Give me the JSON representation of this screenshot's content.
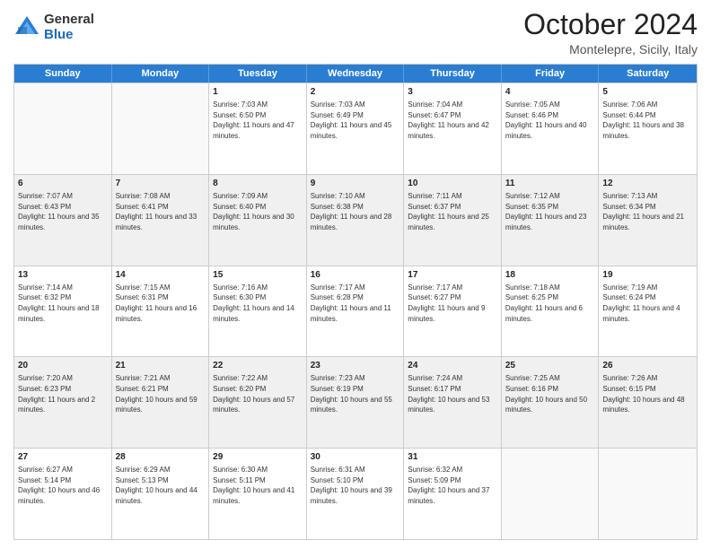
{
  "logo": {
    "general": "General",
    "blue": "Blue"
  },
  "title": {
    "month": "October 2024",
    "location": "Montelepre, Sicily, Italy"
  },
  "weekdays": [
    "Sunday",
    "Monday",
    "Tuesday",
    "Wednesday",
    "Thursday",
    "Friday",
    "Saturday"
  ],
  "weeks": [
    [
      {
        "day": "",
        "sunrise": "",
        "sunset": "",
        "daylight": "",
        "shaded": false,
        "empty": true
      },
      {
        "day": "",
        "sunrise": "",
        "sunset": "",
        "daylight": "",
        "shaded": false,
        "empty": true
      },
      {
        "day": "1",
        "sunrise": "Sunrise: 7:03 AM",
        "sunset": "Sunset: 6:50 PM",
        "daylight": "Daylight: 11 hours and 47 minutes.",
        "shaded": false,
        "empty": false
      },
      {
        "day": "2",
        "sunrise": "Sunrise: 7:03 AM",
        "sunset": "Sunset: 6:49 PM",
        "daylight": "Daylight: 11 hours and 45 minutes.",
        "shaded": false,
        "empty": false
      },
      {
        "day": "3",
        "sunrise": "Sunrise: 7:04 AM",
        "sunset": "Sunset: 6:47 PM",
        "daylight": "Daylight: 11 hours and 42 minutes.",
        "shaded": false,
        "empty": false
      },
      {
        "day": "4",
        "sunrise": "Sunrise: 7:05 AM",
        "sunset": "Sunset: 6:46 PM",
        "daylight": "Daylight: 11 hours and 40 minutes.",
        "shaded": false,
        "empty": false
      },
      {
        "day": "5",
        "sunrise": "Sunrise: 7:06 AM",
        "sunset": "Sunset: 6:44 PM",
        "daylight": "Daylight: 11 hours and 38 minutes.",
        "shaded": false,
        "empty": false
      }
    ],
    [
      {
        "day": "6",
        "sunrise": "Sunrise: 7:07 AM",
        "sunset": "Sunset: 6:43 PM",
        "daylight": "Daylight: 11 hours and 35 minutes.",
        "shaded": true,
        "empty": false
      },
      {
        "day": "7",
        "sunrise": "Sunrise: 7:08 AM",
        "sunset": "Sunset: 6:41 PM",
        "daylight": "Daylight: 11 hours and 33 minutes.",
        "shaded": true,
        "empty": false
      },
      {
        "day": "8",
        "sunrise": "Sunrise: 7:09 AM",
        "sunset": "Sunset: 6:40 PM",
        "daylight": "Daylight: 11 hours and 30 minutes.",
        "shaded": true,
        "empty": false
      },
      {
        "day": "9",
        "sunrise": "Sunrise: 7:10 AM",
        "sunset": "Sunset: 6:38 PM",
        "daylight": "Daylight: 11 hours and 28 minutes.",
        "shaded": true,
        "empty": false
      },
      {
        "day": "10",
        "sunrise": "Sunrise: 7:11 AM",
        "sunset": "Sunset: 6:37 PM",
        "daylight": "Daylight: 11 hours and 25 minutes.",
        "shaded": true,
        "empty": false
      },
      {
        "day": "11",
        "sunrise": "Sunrise: 7:12 AM",
        "sunset": "Sunset: 6:35 PM",
        "daylight": "Daylight: 11 hours and 23 minutes.",
        "shaded": true,
        "empty": false
      },
      {
        "day": "12",
        "sunrise": "Sunrise: 7:13 AM",
        "sunset": "Sunset: 6:34 PM",
        "daylight": "Daylight: 11 hours and 21 minutes.",
        "shaded": true,
        "empty": false
      }
    ],
    [
      {
        "day": "13",
        "sunrise": "Sunrise: 7:14 AM",
        "sunset": "Sunset: 6:32 PM",
        "daylight": "Daylight: 11 hours and 18 minutes.",
        "shaded": false,
        "empty": false
      },
      {
        "day": "14",
        "sunrise": "Sunrise: 7:15 AM",
        "sunset": "Sunset: 6:31 PM",
        "daylight": "Daylight: 11 hours and 16 minutes.",
        "shaded": false,
        "empty": false
      },
      {
        "day": "15",
        "sunrise": "Sunrise: 7:16 AM",
        "sunset": "Sunset: 6:30 PM",
        "daylight": "Daylight: 11 hours and 14 minutes.",
        "shaded": false,
        "empty": false
      },
      {
        "day": "16",
        "sunrise": "Sunrise: 7:17 AM",
        "sunset": "Sunset: 6:28 PM",
        "daylight": "Daylight: 11 hours and 11 minutes.",
        "shaded": false,
        "empty": false
      },
      {
        "day": "17",
        "sunrise": "Sunrise: 7:17 AM",
        "sunset": "Sunset: 6:27 PM",
        "daylight": "Daylight: 11 hours and 9 minutes.",
        "shaded": false,
        "empty": false
      },
      {
        "day": "18",
        "sunrise": "Sunrise: 7:18 AM",
        "sunset": "Sunset: 6:25 PM",
        "daylight": "Daylight: 11 hours and 6 minutes.",
        "shaded": false,
        "empty": false
      },
      {
        "day": "19",
        "sunrise": "Sunrise: 7:19 AM",
        "sunset": "Sunset: 6:24 PM",
        "daylight": "Daylight: 11 hours and 4 minutes.",
        "shaded": false,
        "empty": false
      }
    ],
    [
      {
        "day": "20",
        "sunrise": "Sunrise: 7:20 AM",
        "sunset": "Sunset: 6:23 PM",
        "daylight": "Daylight: 11 hours and 2 minutes.",
        "shaded": true,
        "empty": false
      },
      {
        "day": "21",
        "sunrise": "Sunrise: 7:21 AM",
        "sunset": "Sunset: 6:21 PM",
        "daylight": "Daylight: 10 hours and 59 minutes.",
        "shaded": true,
        "empty": false
      },
      {
        "day": "22",
        "sunrise": "Sunrise: 7:22 AM",
        "sunset": "Sunset: 6:20 PM",
        "daylight": "Daylight: 10 hours and 57 minutes.",
        "shaded": true,
        "empty": false
      },
      {
        "day": "23",
        "sunrise": "Sunrise: 7:23 AM",
        "sunset": "Sunset: 6:19 PM",
        "daylight": "Daylight: 10 hours and 55 minutes.",
        "shaded": true,
        "empty": false
      },
      {
        "day": "24",
        "sunrise": "Sunrise: 7:24 AM",
        "sunset": "Sunset: 6:17 PM",
        "daylight": "Daylight: 10 hours and 53 minutes.",
        "shaded": true,
        "empty": false
      },
      {
        "day": "25",
        "sunrise": "Sunrise: 7:25 AM",
        "sunset": "Sunset: 6:16 PM",
        "daylight": "Daylight: 10 hours and 50 minutes.",
        "shaded": true,
        "empty": false
      },
      {
        "day": "26",
        "sunrise": "Sunrise: 7:26 AM",
        "sunset": "Sunset: 6:15 PM",
        "daylight": "Daylight: 10 hours and 48 minutes.",
        "shaded": true,
        "empty": false
      }
    ],
    [
      {
        "day": "27",
        "sunrise": "Sunrise: 6:27 AM",
        "sunset": "Sunset: 5:14 PM",
        "daylight": "Daylight: 10 hours and 46 minutes.",
        "shaded": false,
        "empty": false
      },
      {
        "day": "28",
        "sunrise": "Sunrise: 6:29 AM",
        "sunset": "Sunset: 5:13 PM",
        "daylight": "Daylight: 10 hours and 44 minutes.",
        "shaded": false,
        "empty": false
      },
      {
        "day": "29",
        "sunrise": "Sunrise: 6:30 AM",
        "sunset": "Sunset: 5:11 PM",
        "daylight": "Daylight: 10 hours and 41 minutes.",
        "shaded": false,
        "empty": false
      },
      {
        "day": "30",
        "sunrise": "Sunrise: 6:31 AM",
        "sunset": "Sunset: 5:10 PM",
        "daylight": "Daylight: 10 hours and 39 minutes.",
        "shaded": false,
        "empty": false
      },
      {
        "day": "31",
        "sunrise": "Sunrise: 6:32 AM",
        "sunset": "Sunset: 5:09 PM",
        "daylight": "Daylight: 10 hours and 37 minutes.",
        "shaded": false,
        "empty": false
      },
      {
        "day": "",
        "sunrise": "",
        "sunset": "",
        "daylight": "",
        "shaded": false,
        "empty": true
      },
      {
        "day": "",
        "sunrise": "",
        "sunset": "",
        "daylight": "",
        "shaded": false,
        "empty": true
      }
    ]
  ]
}
